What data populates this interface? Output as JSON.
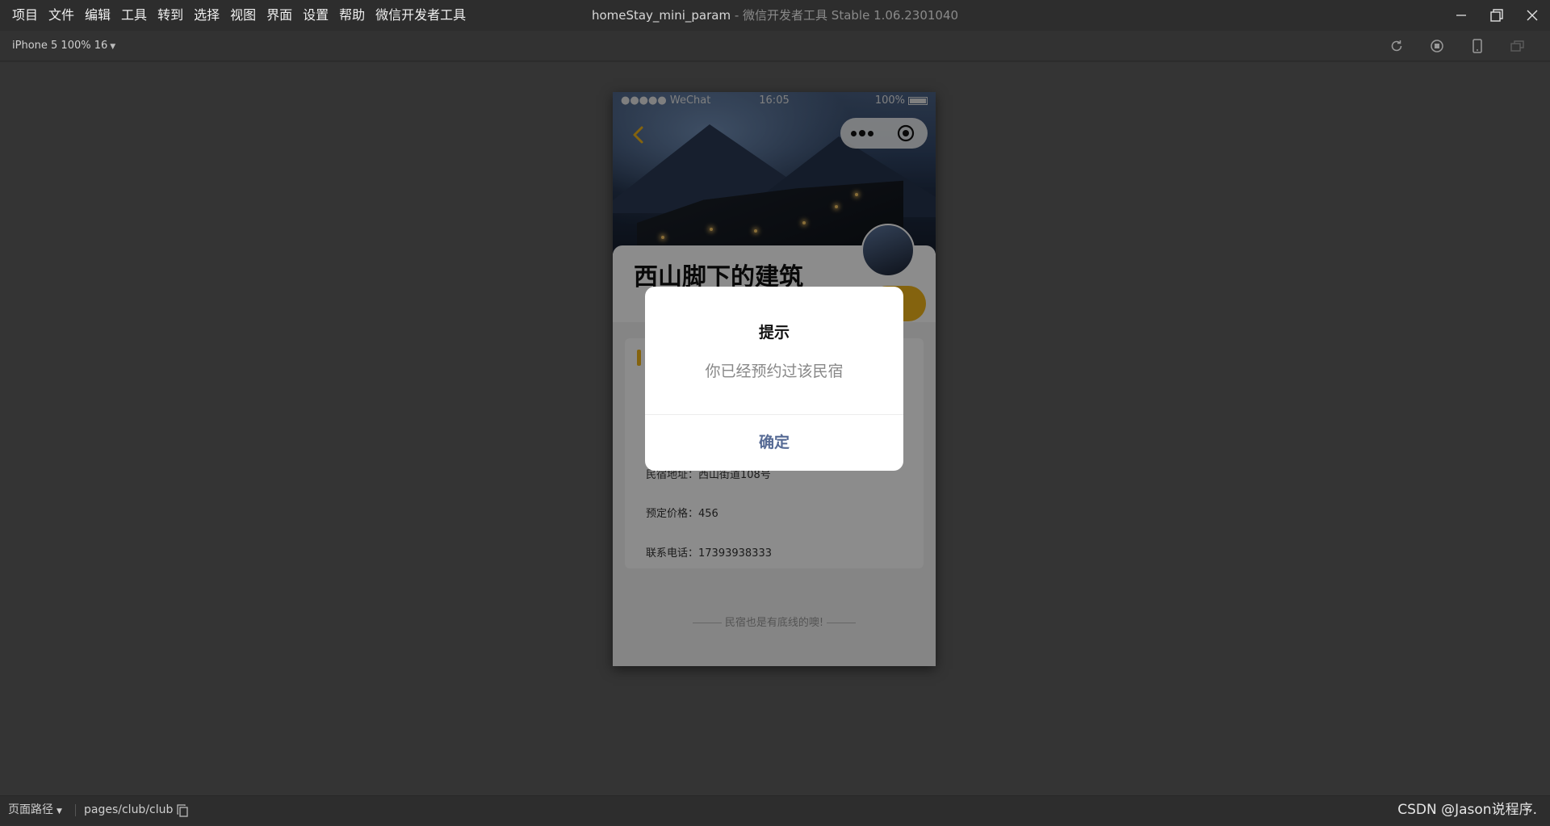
{
  "menu": {
    "items": [
      "项目",
      "文件",
      "编辑",
      "工具",
      "转到",
      "选择",
      "视图",
      "界面",
      "设置",
      "帮助",
      "微信开发者工具"
    ]
  },
  "window": {
    "project_name": "homeStay_mini_param",
    "app_name": " - 微信开发者工具 Stable 1.06.2301040"
  },
  "toolbar": {
    "device": "iPhone 5 100% 16"
  },
  "phone": {
    "status": {
      "carrier": "●●●●● WeChat",
      "time": "16:05",
      "battery": "100%"
    },
    "club_name": "西山脚下的建筑",
    "info_rows": [
      {
        "label": "民宿地址：",
        "value": "西山街道108号"
      },
      {
        "label": "预定价格：",
        "value": "456"
      },
      {
        "label": "联系电话：",
        "value": "17393938333"
      }
    ],
    "footer_note": "民宿也是有底线的噢!"
  },
  "dialog": {
    "title": "提示",
    "message": "你已经预约过该民宿",
    "confirm": "确定"
  },
  "bottombar": {
    "path_label": "页面路径",
    "path_value": "pages/club/club",
    "watermark": "CSDN @Jason说程序."
  },
  "colors": {
    "accent_gold": "#f0b41a",
    "dialog_button": "#576b95"
  }
}
